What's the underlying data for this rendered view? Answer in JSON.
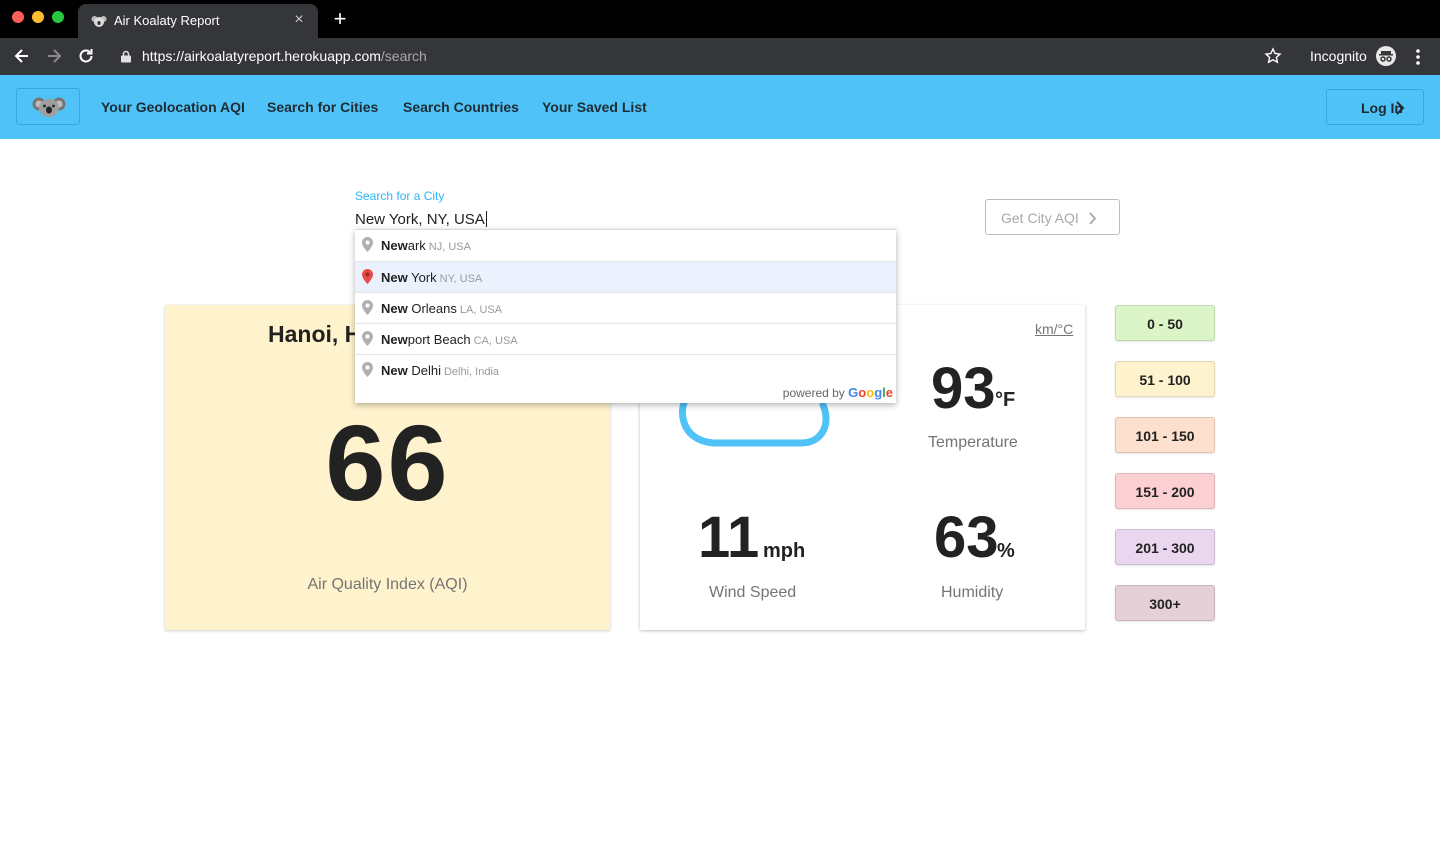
{
  "browser": {
    "tab_title": "Air Koalaty Report",
    "tab_close": "×",
    "new_tab": "+",
    "url_host": "https://airkoalatyreport.herokuapp.com",
    "url_path": "/search",
    "profile_label": "Incognito"
  },
  "nav": {
    "links": [
      "Your Geolocation AQI",
      "Search for Cities",
      "Search Countries",
      "Your Saved List"
    ],
    "login_label": "Log In"
  },
  "search": {
    "label": "Search for a City",
    "value": "New York, NY, USA",
    "button_label": "Get City AQI"
  },
  "autocomplete": {
    "items": [
      {
        "match": "New",
        "rest": "ark",
        "secondary": "NJ, USA",
        "active": false
      },
      {
        "match": "New",
        "rest": " York",
        "secondary": "NY, USA",
        "active": true
      },
      {
        "match": "New",
        "rest": " Orleans",
        "secondary": "LA, USA",
        "active": false
      },
      {
        "match": "New",
        "rest": "port Beach",
        "secondary": "CA, USA",
        "active": false
      },
      {
        "match": "New",
        "rest": " Delhi",
        "secondary": "Delhi, India",
        "active": false
      }
    ],
    "powered_by": "powered by",
    "google_letters": [
      "G",
      "o",
      "o",
      "g",
      "l",
      "e"
    ],
    "google_colors": [
      "#4285f4",
      "#ea4335",
      "#fbbc05",
      "#4285f4",
      "#34a853",
      "#ea4335"
    ]
  },
  "aqi_card": {
    "city": "Hanoi, H",
    "aqi": "66",
    "caption": "Air Quality Index (AQI)",
    "background": "#fff3cd"
  },
  "weather_card": {
    "units_toggle": "km/°C",
    "temperature": "93",
    "temperature_unit": "°F",
    "temperature_caption": "Temperature",
    "wind": "11",
    "wind_unit": "mph",
    "wind_caption": "Wind Speed",
    "humidity": "63",
    "humidity_unit": "%",
    "humidity_caption": "Humidity"
  },
  "legend": [
    {
      "label": "0 - 50",
      "color": "#dcf5c8"
    },
    {
      "label": "51 - 100",
      "color": "#fff3cd"
    },
    {
      "label": "101 - 150",
      "color": "#fde0cd"
    },
    {
      "label": "151 - 200",
      "color": "#fcd0d3"
    },
    {
      "label": "201 - 300",
      "color": "#ead6ee"
    },
    {
      "label": "300+",
      "color": "#e6d0d8"
    }
  ],
  "colors": {
    "nav_bg": "#4fc3f7",
    "accent": "#29b6f6",
    "active_pin": "#e94b4b"
  }
}
